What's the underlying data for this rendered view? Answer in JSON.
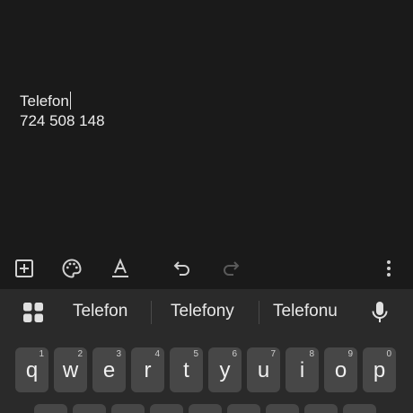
{
  "note": {
    "title": "Telefon",
    "body": "724 508 148"
  },
  "toolbar": {
    "icons": [
      "add-box-icon",
      "palette-icon",
      "text-format-icon",
      "undo-icon",
      "redo-icon",
      "more-vert-icon"
    ]
  },
  "keyboard": {
    "suggestions": [
      "Telefon",
      "Telefony",
      "Telefonu"
    ],
    "keys": [
      {
        "ch": "q",
        "num": "1"
      },
      {
        "ch": "w",
        "num": "2"
      },
      {
        "ch": "e",
        "num": "3"
      },
      {
        "ch": "r",
        "num": "4"
      },
      {
        "ch": "t",
        "num": "5"
      },
      {
        "ch": "y",
        "num": "6"
      },
      {
        "ch": "u",
        "num": "7"
      },
      {
        "ch": "i",
        "num": "8"
      },
      {
        "ch": "o",
        "num": "9"
      },
      {
        "ch": "p",
        "num": "0"
      }
    ]
  },
  "colors": {
    "background": "#1a1a1a",
    "keyboard": "#2a2a2a",
    "key": "#474747",
    "text": "#ececec"
  }
}
